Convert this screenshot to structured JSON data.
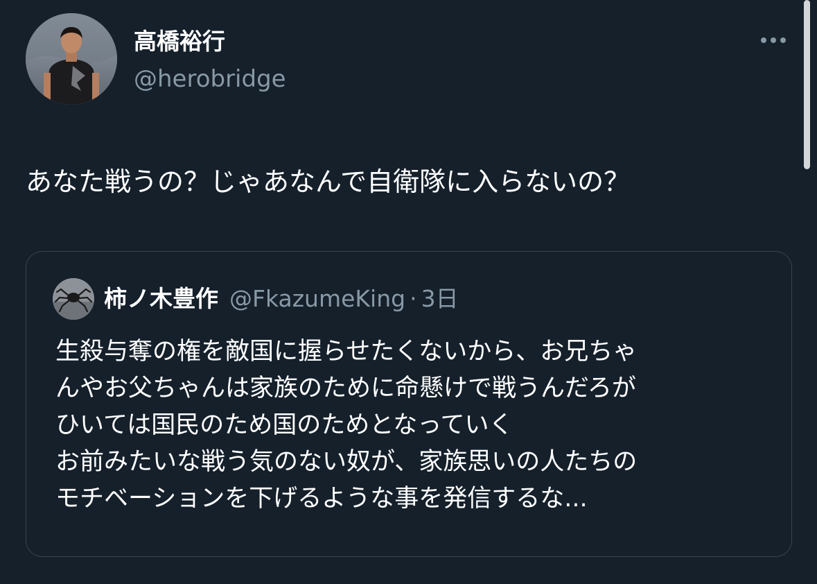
{
  "tweet": {
    "author_name": "高橋裕行",
    "author_handle": "@herobridge",
    "text": "あなた戦うの？じゃあなんで自衛隊に入らないの？",
    "more_icon": "more-horizontal-icon"
  },
  "quoted_tweet": {
    "author_name": "柿ノ木豊作",
    "author_handle": "@FkazumeKing",
    "separator": "·",
    "time": "3日",
    "lines": [
      "生殺与奪の権を敵国に握らせたくないから、お兄ちゃ",
      "んやお父ちゃんは家族のために命懸けで戦うんだろが",
      "ひいては国民のため国のためとなっていく",
      "お前みたいな戦う気のない奴が、家族思いの人たちの",
      "モチベーションを下げるような事を発信するな..."
    ]
  },
  "colors": {
    "background": "#15202b",
    "secondary_text": "#8899a6",
    "border": "#38444d"
  }
}
